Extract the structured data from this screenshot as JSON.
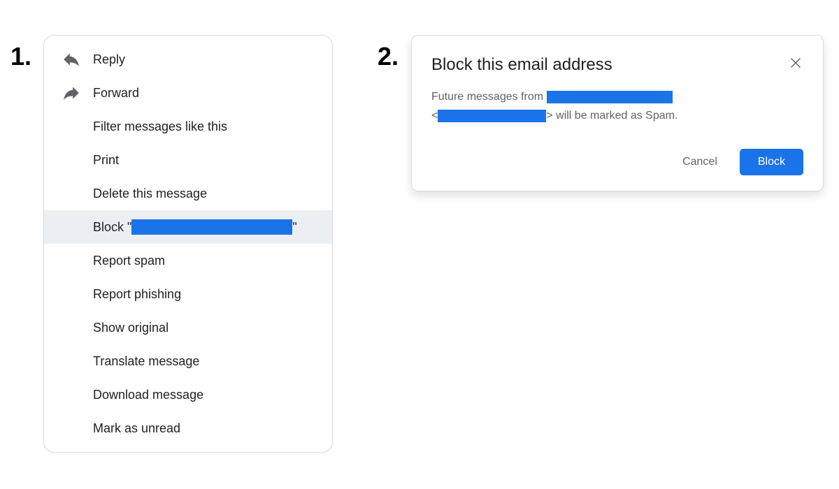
{
  "steps": {
    "one": "1.",
    "two": "2."
  },
  "menu": {
    "items": [
      {
        "label": "Reply",
        "icon": "reply"
      },
      {
        "label": "Forward",
        "icon": "forward"
      },
      {
        "label": "Filter messages like this",
        "icon": null
      },
      {
        "label": "Print",
        "icon": null
      },
      {
        "label": "Delete this message",
        "icon": null
      },
      {
        "prefix": "Block \"",
        "suffix": "\"",
        "icon": null,
        "selected": true,
        "redacted_name": true
      },
      {
        "label": "Report spam",
        "icon": null
      },
      {
        "label": "Report phishing",
        "icon": null
      },
      {
        "label": "Show original",
        "icon": null
      },
      {
        "label": "Translate message",
        "icon": null
      },
      {
        "label": "Download message",
        "icon": null
      },
      {
        "label": "Mark as unread",
        "icon": null
      }
    ]
  },
  "dialog": {
    "title": "Block this email address",
    "body_prefix": "Future messages from ",
    "body_mid_open": "<",
    "body_mid_close": ">",
    "body_suffix": " will be marked as Spam.",
    "cancel_label": "Cancel",
    "block_label": "Block"
  }
}
